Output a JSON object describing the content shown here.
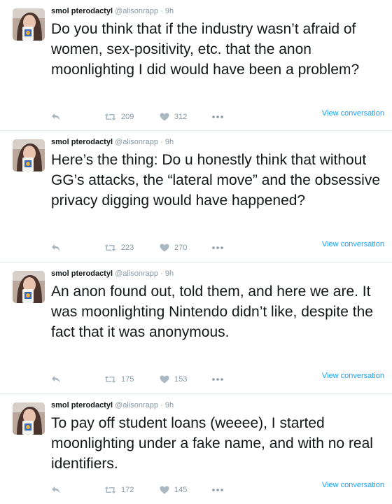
{
  "colors": {
    "link": "#1da1f2",
    "muted": "#8899a6",
    "icon": "#aab8c2",
    "divider": "#e1e8ed"
  },
  "tweets": [
    {
      "name": "smol pterodactyl",
      "handle": "@alisonrapp",
      "dot": "·",
      "time": "9h",
      "text": "Do you think that if the industry wasn’t afraid of women, sex-positivity, etc. that the anon moonlighting I did would have been a problem?",
      "retweets": "209",
      "likes": "312",
      "view_link": "View conversation",
      "icons": [
        "reply-icon",
        "retweet-icon",
        "heart-icon",
        "more-icon"
      ]
    },
    {
      "name": "smol pterodactyl",
      "handle": "@alisonrapp",
      "dot": "·",
      "time": "9h",
      "text": "Here’s the thing: Do u honestly think that without GG’s attacks, the “lateral move” and the obsessive privacy digging would have happened?",
      "retweets": "223",
      "likes": "270",
      "view_link": "View conversation",
      "icons": [
        "reply-icon",
        "retweet-icon",
        "heart-icon",
        "more-icon"
      ]
    },
    {
      "name": "smol pterodactyl",
      "handle": "@alisonrapp",
      "dot": "·",
      "time": "9h",
      "text": "An anon found out, told them, and here we are. It was moonlighting Nintendo didn’t like, despite the fact that it was anonymous.",
      "retweets": "175",
      "likes": "153",
      "view_link": "View conversation",
      "icons": [
        "reply-icon",
        "retweet-icon",
        "heart-icon",
        "more-icon"
      ]
    },
    {
      "name": "smol pterodactyl",
      "handle": "@alisonrapp",
      "dot": "·",
      "time": "9h",
      "text": "To pay off student loans (weeee), I started moonlighting under a fake name, and with no real identifiers.",
      "retweets": "172",
      "likes": "145",
      "view_link": "View conversation",
      "icons": [
        "reply-icon",
        "retweet-icon",
        "heart-icon",
        "more-icon"
      ]
    }
  ]
}
